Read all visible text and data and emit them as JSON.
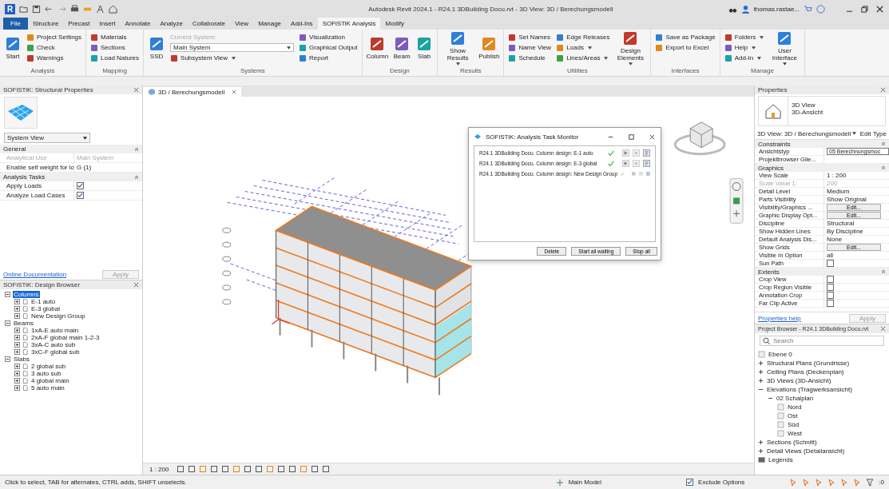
{
  "window": {
    "app_letter": "R",
    "title": "Autodesk Revit 2024.1 - R24.1 3DBuilding Docu.rvt - 3D View: 3D / Berechungsmodell",
    "user": "thomas.rastae..."
  },
  "menu_tabs": [
    {
      "label": "File",
      "kind": "file",
      "selected": false
    },
    {
      "label": "Structure",
      "kind": "tab",
      "selected": false
    },
    {
      "label": "Precast",
      "kind": "tab",
      "selected": false
    },
    {
      "label": "Insert",
      "kind": "tab",
      "selected": false
    },
    {
      "label": "Annotate",
      "kind": "tab",
      "selected": false
    },
    {
      "label": "Analyze",
      "kind": "tab",
      "selected": false
    },
    {
      "label": "Collaborate",
      "kind": "tab",
      "selected": false
    },
    {
      "label": "View",
      "kind": "tab",
      "selected": false
    },
    {
      "label": "Manage",
      "kind": "tab",
      "selected": false
    },
    {
      "label": "Add-Ins",
      "kind": "tab",
      "selected": false
    },
    {
      "label": "SOFiSTiK Analysis",
      "kind": "tab",
      "selected": true
    },
    {
      "label": "Modify",
      "kind": "tab",
      "selected": false
    }
  ],
  "ribbon": [
    {
      "title": "Analysis",
      "items": [
        {
          "kind": "large",
          "label": "Start"
        },
        {
          "kind": "small",
          "label": "Project Settings"
        },
        {
          "kind": "small",
          "label": "Check"
        },
        {
          "kind": "small",
          "label": "Warnings"
        }
      ]
    },
    {
      "title": "Mapping",
      "items": [
        {
          "kind": "small",
          "label": "Materials"
        },
        {
          "kind": "small",
          "label": "Sections"
        },
        {
          "kind": "small",
          "label": "Load Natures"
        }
      ]
    },
    {
      "title": "Systems",
      "items": [
        {
          "kind": "large",
          "label": "SSD"
        },
        {
          "kind": "caption",
          "label": "Current System:"
        },
        {
          "kind": "combo",
          "label": "Main System"
        },
        {
          "kind": "small",
          "label": "Subsystem View",
          "dropdown": true
        },
        {
          "kind": "small",
          "label": "Visualization"
        },
        {
          "kind": "small",
          "label": "Graphical Output"
        },
        {
          "kind": "small",
          "label": "Report"
        }
      ]
    },
    {
      "title": "Design",
      "items": [
        {
          "kind": "large",
          "label": "Column"
        },
        {
          "kind": "large",
          "label": "Beam"
        },
        {
          "kind": "large",
          "label": "Slab"
        }
      ]
    },
    {
      "title": "Results",
      "items": [
        {
          "kind": "large",
          "label": "Show Results",
          "dropdown": true
        },
        {
          "kind": "large",
          "label": "Publish"
        }
      ]
    },
    {
      "title": "Utilities",
      "items": [
        {
          "kind": "small",
          "label": "Set Names"
        },
        {
          "kind": "small",
          "label": "Name View"
        },
        {
          "kind": "small",
          "label": "Schedule"
        },
        {
          "kind": "small",
          "label": "Edge Releases"
        },
        {
          "kind": "small",
          "label": "Loads",
          "dropdown": true
        },
        {
          "kind": "small",
          "label": "Lines/Areas",
          "dropdown": true
        },
        {
          "kind": "large",
          "label": "Design Elements",
          "dropdown": true
        }
      ]
    },
    {
      "title": "Interfaces",
      "items": [
        {
          "kind": "small",
          "label": "Save as Package"
        },
        {
          "kind": "small",
          "label": "Export to Excel"
        }
      ]
    },
    {
      "title": "Manage",
      "items": [
        {
          "kind": "small",
          "label": "Folders",
          "dropdown": true
        },
        {
          "kind": "small",
          "label": "Help",
          "dropdown": true
        },
        {
          "kind": "small",
          "label": "Add-In",
          "dropdown": true
        },
        {
          "kind": "large",
          "label": "User Interface",
          "dropdown": true
        }
      ]
    }
  ],
  "structural_properties": {
    "title": "SOFiSTiK: Structural Properties",
    "view_selector": "System View",
    "groups": [
      {
        "title": "General",
        "rows": [
          {
            "label": "Analytical Use",
            "kind": "text",
            "value": "Main System",
            "disabled": true
          },
          {
            "label": "Enable self weight for lo",
            "kind": "text",
            "value": "G (1)",
            "disabled": false
          }
        ]
      },
      {
        "title": "Analysis Tasks",
        "rows": [
          {
            "label": "Apply Loads",
            "kind": "check",
            "checked": true,
            "disabled": false
          },
          {
            "label": "Analyze Load Cases",
            "kind": "check",
            "checked": true,
            "disabled": false
          }
        ]
      }
    ],
    "help_link": "Online Documentation",
    "apply": {
      "label": "Apply",
      "disabled": true
    }
  },
  "design_browser": {
    "title": "SOFiSTiK: Design Browser",
    "nodes": [
      {
        "label": "Columns",
        "expanded": true,
        "selected": true,
        "children": [
          {
            "label": "E-1 auto",
            "expanded": false,
            "selected": false
          },
          {
            "label": "E-3 global",
            "expanded": false,
            "selected": false
          },
          {
            "label": "New Design Group",
            "expanded": false,
            "selected": false
          }
        ]
      },
      {
        "label": "Beams",
        "expanded": true,
        "selected": false,
        "children": [
          {
            "label": "1xA-E auto main",
            "expanded": false,
            "selected": false
          },
          {
            "label": "2xA-F global main 1-2-3",
            "expanded": false,
            "selected": false
          },
          {
            "label": "3xA-C auto sub",
            "expanded": false,
            "selected": false
          },
          {
            "label": "3xC-F global sub",
            "expanded": false,
            "selected": false
          }
        ]
      },
      {
        "label": "Slabs",
        "expanded": true,
        "selected": false,
        "children": [
          {
            "label": "2 global sub",
            "expanded": false,
            "selected": false
          },
          {
            "label": "3 auto sub",
            "expanded": false,
            "selected": false
          },
          {
            "label": "4 global main",
            "expanded": false,
            "selected": false
          },
          {
            "label": "5 auto main",
            "expanded": false,
            "selected": false
          }
        ]
      }
    ]
  },
  "view": {
    "tab": "3D / Berechungsmodell",
    "scale": "1 : 200"
  },
  "task_monitor": {
    "title": "SOFiSTiK: Analysis Task Monitor",
    "tasks": [
      {
        "label": "R24.1 3DBuilding Docu. Column design: E-1 auto",
        "done": true
      },
      {
        "label": "R24.1 3DBuilding Docu. Column design: E-3 global",
        "done": true
      },
      {
        "label": "R24.1 3DBuilding Docu. Column design: New Design Group",
        "done": true
      }
    ],
    "buttons": [
      "Delete",
      "Start all waiting",
      "Stop all"
    ]
  },
  "properties": {
    "title": "Properties",
    "type_name": "3D View",
    "type_sub": "3D-Ansicht",
    "instance": "3D View: 3D / Berechungsmodell",
    "edit_type": "Edit Type",
    "groups": [
      {
        "title": "Constraints",
        "rows": [
          {
            "label": "Ansichtstyp",
            "kind": "input",
            "value": "05 Berechnungsmoc",
            "disabled": false
          },
          {
            "label": "Projektbrowser Glie...",
            "kind": "text",
            "disabled": false
          }
        ]
      },
      {
        "title": "Graphics",
        "rows": [
          {
            "label": "View Scale",
            "kind": "text",
            "value": "1 : 200",
            "disabled": false
          },
          {
            "label": "Scale Value    1:",
            "kind": "text",
            "value": "200",
            "disabled": true
          },
          {
            "label": "Detail Level",
            "kind": "text",
            "value": "Medium",
            "disabled": false
          },
          {
            "label": "Parts Visibility",
            "kind": "text",
            "value": "Show Original",
            "disabled": false
          },
          {
            "label": "Visibility/Graphics ...",
            "kind": "button",
            "value": "Edit...",
            "disabled": false
          },
          {
            "label": "Graphic Display Opt...",
            "kind": "button",
            "value": "Edit...",
            "disabled": false
          },
          {
            "label": "Discipline",
            "kind": "text",
            "value": "Structural",
            "disabled": false
          },
          {
            "label": "Show Hidden Lines",
            "kind": "text",
            "value": "By Discipline",
            "disabled": false
          },
          {
            "label": "Default Analysis Dis...",
            "kind": "text",
            "value": "None",
            "disabled": false
          },
          {
            "label": "Show Grids",
            "kind": "button",
            "value": "Edit...",
            "disabled": false
          },
          {
            "label": "Visible In Option",
            "kind": "text",
            "value": "all",
            "disabled": false
          },
          {
            "label": "Sun Path",
            "kind": "check",
            "checked": false,
            "disabled": false
          }
        ]
      },
      {
        "title": "Extents",
        "rows": [
          {
            "label": "Crop View",
            "kind": "check",
            "checked": false,
            "disabled": false
          },
          {
            "label": "Crop Region Visible",
            "kind": "check",
            "checked": false,
            "disabled": false
          },
          {
            "label": "Annotation Crop",
            "kind": "check",
            "checked": false,
            "disabled": false
          },
          {
            "label": "Far Clip Active",
            "kind": "check",
            "checked": false,
            "disabled": false
          }
        ]
      }
    ],
    "help_link": "Properties help",
    "apply": {
      "label": "Apply",
      "disabled": true
    }
  },
  "project_browser": {
    "title": "Project Browser - R24.1 3DBuilding Docu.rvt",
    "search": {
      "placeholder": "Search"
    },
    "nodes": [
      {
        "label": "Ebene 0",
        "kind": "view"
      },
      {
        "label": "Structural Plans (Grundrisse)",
        "kind": "group",
        "expanded": false
      },
      {
        "label": "Ceiling Plans (Deckenplan)",
        "kind": "group",
        "expanded": false
      },
      {
        "label": "3D Views (3D-Ansicht)",
        "kind": "group",
        "expanded": false
      },
      {
        "label": "Elevations (Tragwerksansicht)",
        "kind": "group",
        "expanded": true,
        "children": [
          {
            "label": "02 Schalplan",
            "kind": "group",
            "expanded": true,
            "children": [
              {
                "label": "Nord",
                "kind": "view"
              },
              {
                "label": "Ost",
                "kind": "view"
              },
              {
                "label": "Süd",
                "kind": "view"
              },
              {
                "label": "West",
                "kind": "view"
              }
            ]
          }
        ]
      },
      {
        "label": "Sections (Schnitt)",
        "kind": "group",
        "expanded": false
      },
      {
        "label": "Detail Views (Detailansicht)",
        "kind": "group",
        "expanded": false
      },
      {
        "label": "Legends",
        "kind": "legend"
      }
    ]
  },
  "status_bar": {
    "hint": "Click to select, TAB for alternates, CTRL adds, SHIFT unselects.",
    "model": "Main Model",
    "exclude_options": {
      "label": "Exclude Options",
      "checked": true
    },
    "filter_count": ":0"
  }
}
